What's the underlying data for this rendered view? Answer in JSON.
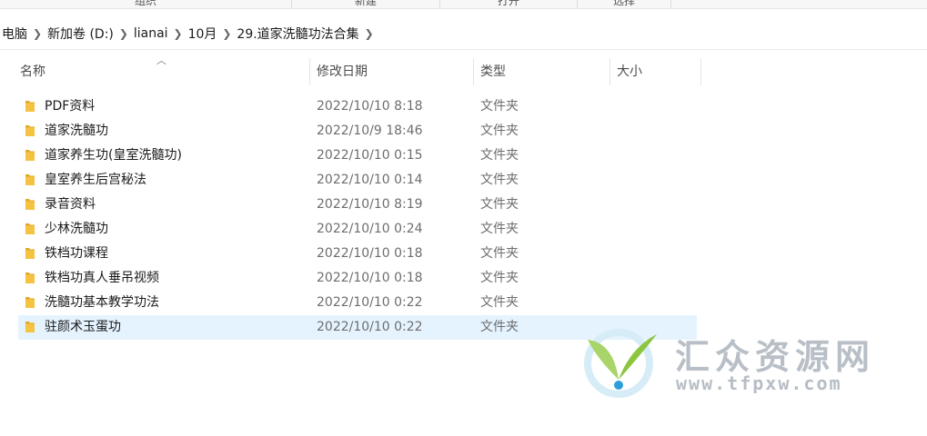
{
  "ribbon": {
    "groups": [
      "组织",
      "新建",
      "打开",
      "选择"
    ]
  },
  "breadcrumb": [
    "电脑",
    "新加卷 (D:)",
    "lianai",
    "10月",
    "29.道家洗髓功法合集"
  ],
  "columns": {
    "name": "名称",
    "date": "修改日期",
    "type": "类型",
    "size": "大小"
  },
  "files": [
    {
      "name": "PDF资料",
      "date": "2022/10/10 8:18",
      "type": "文件夹"
    },
    {
      "name": "道家洗髓功",
      "date": "2022/10/9 18:46",
      "type": "文件夹"
    },
    {
      "name": "道家养生功(皇室洗髓功)",
      "date": "2022/10/10 0:15",
      "type": "文件夹"
    },
    {
      "name": "皇室养生后宫秘法",
      "date": "2022/10/10 0:14",
      "type": "文件夹"
    },
    {
      "name": "录音资料",
      "date": "2022/10/10 8:19",
      "type": "文件夹"
    },
    {
      "name": "少林洗髓功",
      "date": "2022/10/10 0:24",
      "type": "文件夹"
    },
    {
      "name": "铁档功课程",
      "date": "2022/10/10 0:18",
      "type": "文件夹"
    },
    {
      "name": "铁档功真人垂吊视频",
      "date": "2022/10/10 0:18",
      "type": "文件夹"
    },
    {
      "name": "洗髓功基本教学功法",
      "date": "2022/10/10 0:22",
      "type": "文件夹"
    },
    {
      "name": "驻颜术玉蛋功",
      "date": "2022/10/10 0:22",
      "type": "文件夹"
    }
  ],
  "selected_index": 9,
  "watermark": {
    "title": "汇众资源网",
    "url": "www.tfpxw.com"
  },
  "colors": {
    "folder": "#f5c342",
    "selection": "#e5f3ff",
    "watermark_green": "#8cc63f",
    "watermark_blue": "#2d9fd8"
  }
}
